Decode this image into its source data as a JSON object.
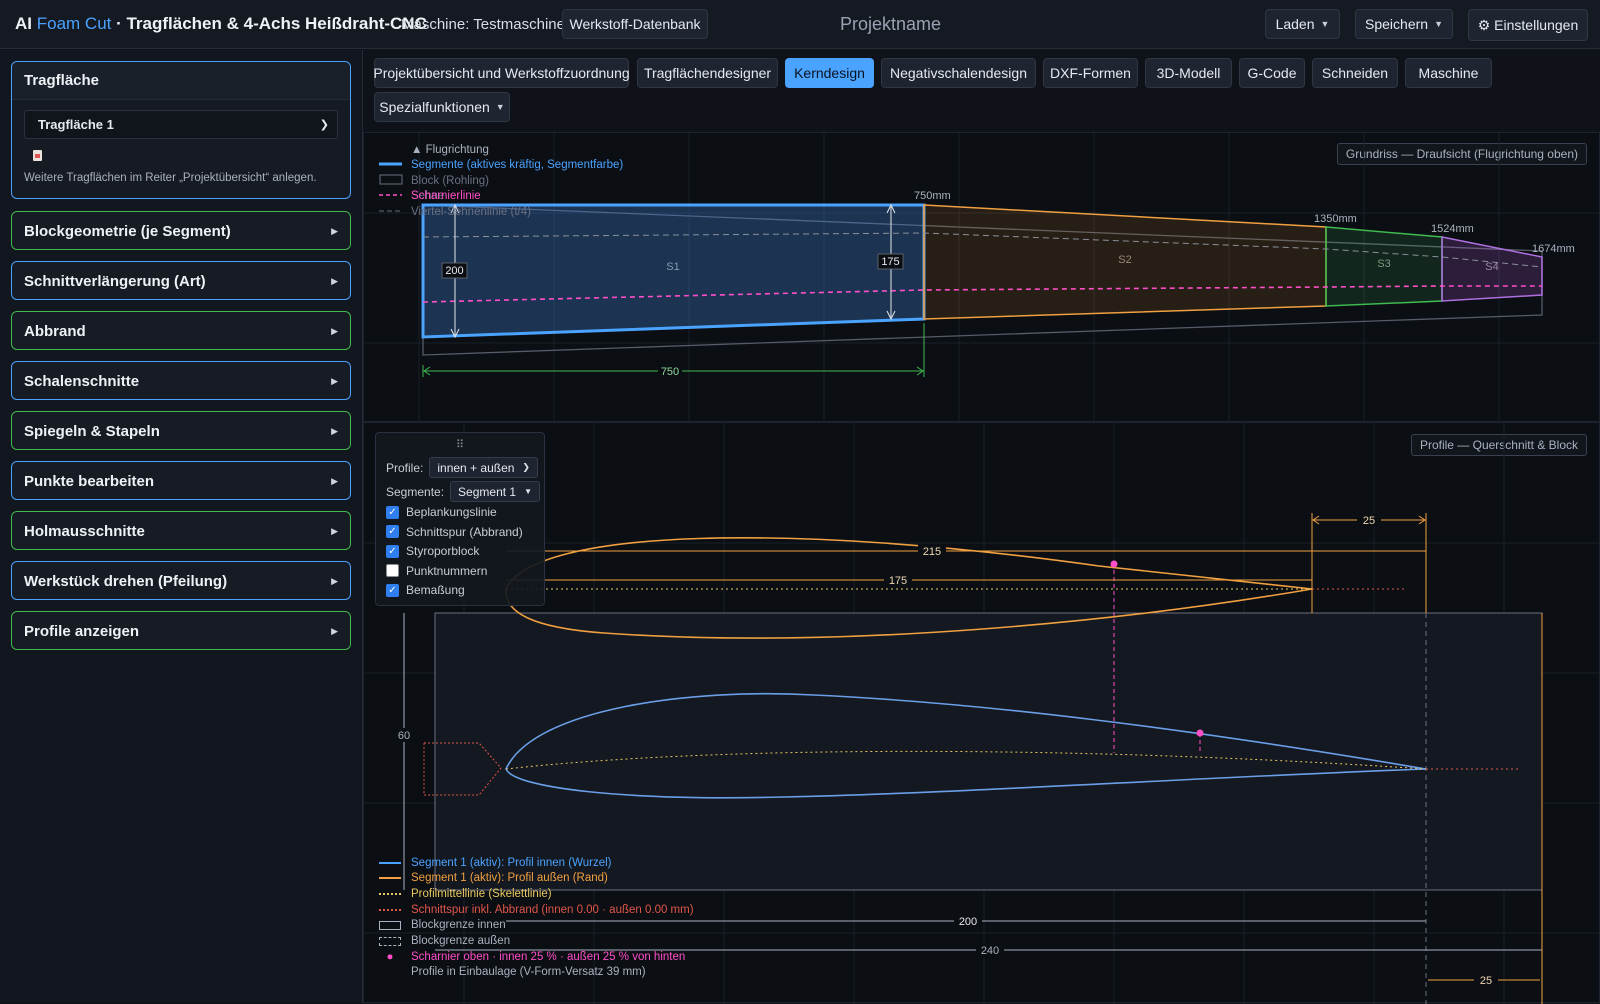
{
  "header": {
    "brand_prefix": "AI ",
    "brand_accent": "Foam Cut",
    "brand_suffix": " · Tragflächen & 4-Achs Heißdraht-CNC",
    "machine": "Maschine: Testmaschine",
    "db_button": "Werkstoff-Datenbank",
    "project_name": "Projektname",
    "load": "Laden",
    "save": "Speichern",
    "settings": "⚙ Einstellungen"
  },
  "sidebar": {
    "tragflaeche": {
      "title": "Tragfläche",
      "selected": "Tragfläche 1",
      "hint": "Weitere Tragflächen im Reiter „Projektübersicht“ anlegen."
    },
    "panels": [
      {
        "label": "Blockgeometrie (je Segment)",
        "color": "#3fb950"
      },
      {
        "label": "Schnittverlängerung (Art)",
        "color": "#4aa3ff"
      },
      {
        "label": "Abbrand",
        "color": "#3fb950"
      },
      {
        "label": "Schalenschnitte",
        "color": "#4aa3ff"
      },
      {
        "label": "Spiegeln & Stapeln",
        "color": "#3fb950"
      },
      {
        "label": "Punkte bearbeiten",
        "color": "#4aa3ff"
      },
      {
        "label": "Holmausschnitte",
        "color": "#3fb950"
      },
      {
        "label": "Werkstück drehen (Pfeilung)",
        "color": "#4aa3ff"
      },
      {
        "label": "Profile anzeigen",
        "color": "#3fb950"
      }
    ]
  },
  "tabs": [
    "Projektübersicht und Werkstoffzuordnung",
    "Tragflächendesigner",
    "Kerndesign",
    "Negativschalendesign",
    "DXF-Formen",
    "3D-Modell",
    "G-Code",
    "Schneiden",
    "Maschine",
    "Spezialfunktionen"
  ],
  "active_tab": "Kerndesign",
  "top_view": {
    "label": "Grundriss — Draufsicht (Flugrichtung oben)",
    "legend": {
      "direction": "▲ Flugrichtung",
      "segments": "Segmente (aktives kräftig, Segmentfarbe)",
      "block": "Block (Rohling)",
      "chord": "Sehne",
      "hinge": "Scharnierlinie",
      "quarter": "Viertel-Sehnenlinie (t/4)"
    },
    "segments": [
      "S1",
      "S2",
      "S3",
      "S4"
    ],
    "stations": [
      "750mm",
      "1350mm",
      "1524mm",
      "1674mm"
    ],
    "dims": {
      "root": "200",
      "s1_tip": "175",
      "span": "750"
    }
  },
  "profile_view": {
    "label": "Profile — Querschnitt & Block",
    "profiles_label": "Profile:",
    "profiles_value": "innen + außen",
    "segments_label": "Segmente:",
    "segments_value": "Segment 1",
    "checkboxes": [
      {
        "label": "Beplankungslinie",
        "checked": true
      },
      {
        "label": "Schnittspur (Abbrand)",
        "checked": true
      },
      {
        "label": "Styroporblock",
        "checked": true
      },
      {
        "label": "Punktnummern",
        "checked": false
      },
      {
        "label": "Bemaßung",
        "checked": true
      }
    ],
    "dims": {
      "outer_len": "215",
      "outer_chord": "175",
      "te_offset": "25",
      "height": "60",
      "inner_len": "200",
      "block_len": "240",
      "te_offset_bottom": "25"
    },
    "legend": [
      {
        "text": "Segment 1 (aktiv): Profil innen (Wurzel)",
        "color": "#4aa3ff"
      },
      {
        "text": "Segment 1 (aktiv): Profil außen (Rand)",
        "color": "#f0a040"
      },
      {
        "text": "Profilmittellinie (Skelettlinie)",
        "color": "#e8c860"
      },
      {
        "text": "Schnittspur inkl. Abbrand (innen 0.00 · außen 0.00 mm)",
        "color": "#e0564a"
      },
      {
        "text": "Blockgrenze innen",
        "color": "#aab2bf"
      },
      {
        "text": "Blockgrenze außen",
        "color": "#aab2bf"
      },
      {
        "text": "Scharnier oben · innen 25 % · außen 25 % von hinten",
        "color": "#ff4fc8"
      },
      {
        "text": "Profile in Einbaulage (V-Form-Versatz 39 mm)",
        "color": "#aab2bf"
      }
    ]
  }
}
